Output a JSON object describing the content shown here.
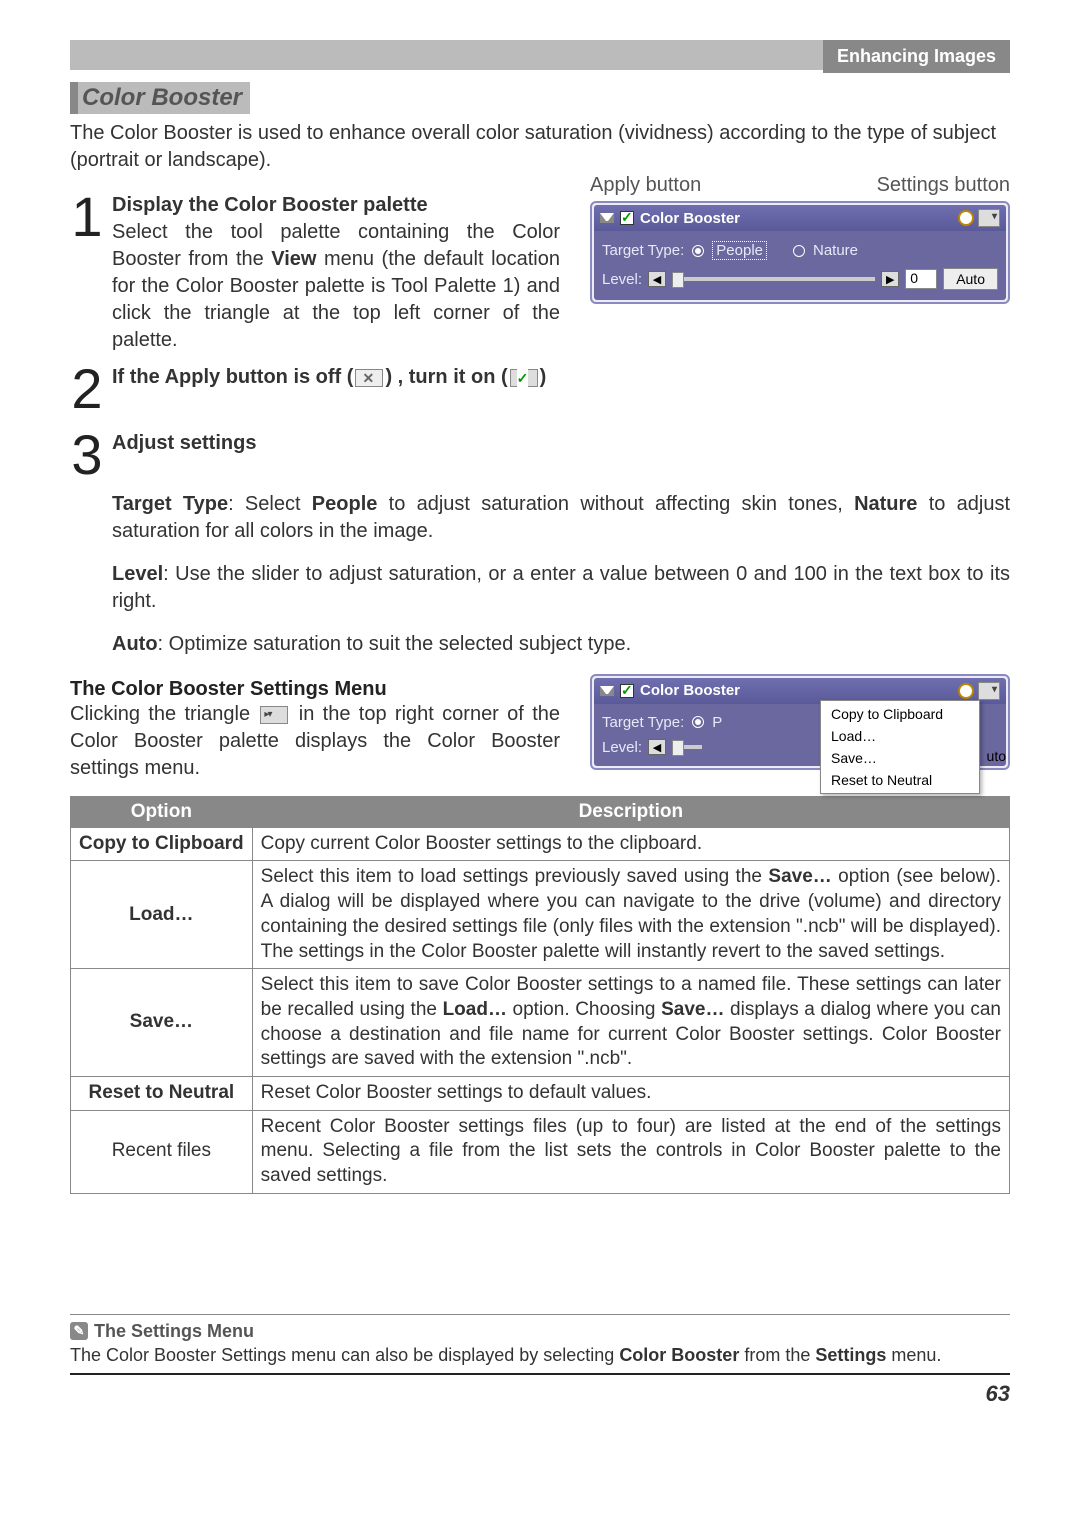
{
  "header": {
    "tab": "Enhancing Images"
  },
  "title": "Color Booster",
  "intro": "The Color Booster is used to enhance overall color saturation (vividness) according to the type of subject (portrait or landscape).",
  "steps": {
    "s1": {
      "num": "1",
      "head": "Display the Color Booster palette",
      "desc_pre": "Select the tool palette containing the Color Booster from the ",
      "desc_bold": "View",
      "desc_post": " menu (the default location for the Color Booster palette is Tool Palette 1) and click the triangle at the top left corner of the palette."
    },
    "s2": {
      "num": "2",
      "head_pre": "If the Apply button is off (",
      "head_mid": ") , turn it on (",
      "head_post": ")"
    },
    "s3": {
      "num": "3",
      "head": "Adjust settings",
      "target_label": "Target Type",
      "target_text_pre": ": Select ",
      "target_b1": "People",
      "target_mid": " to adjust saturation without affecting skin tones, ",
      "target_b2": "Nature",
      "target_post": " to adjust saturation for all colors in the image.",
      "level_label": "Level",
      "level_text": ": Use the slider to adjust saturation, or a enter a value between 0 and 100 in the text box to its right.",
      "auto_label": "Auto",
      "auto_text": ": Optimize saturation to suit the selected subject type."
    }
  },
  "palette_labels": {
    "apply": "Apply button",
    "settings": "Settings button"
  },
  "palette": {
    "title": "Color Booster",
    "target_label": "Target Type:",
    "opt_people": "People",
    "opt_nature": "Nature",
    "level_label": "Level:",
    "level_value": "0",
    "auto": "Auto"
  },
  "settings_menu_section": {
    "head": "The Color Booster Settings Menu",
    "body_pre": "Clicking the triangle ",
    "body_post": " in the top right corner of the Color Booster palette displays the Color Booster settings menu."
  },
  "menu_items": {
    "copy": "Copy to Clipboard",
    "load": "Load…",
    "save": "Save…",
    "reset": "Reset to Neutral"
  },
  "uto": "uto",
  "table": {
    "h1": "Option",
    "h2": "Description",
    "r1n": "Copy to Clipboard",
    "r1d": "Copy current Color Booster settings to the clipboard.",
    "r2n": "Load…",
    "r2d_pre": "Select this item to load settings previously saved using the ",
    "r2d_b": "Save…",
    "r2d_post": " option (see below).  A dialog will be displayed where you can navigate to the drive (volume) and directory containing the desired settings file (only files with the extension \".ncb\" will be displayed).  The settings in the Color Booster palette will instantly revert to the saved settings.",
    "r3n": "Save…",
    "r3d_1": "Select this item to save Color Booster settings to a named file.  These settings can later be recalled using the ",
    "r3d_b1": "Load…",
    "r3d_2": " option.  Choosing ",
    "r3d_b2": "Save…",
    "r3d_3": " displays a dialog where you can choose a destination and file name for current Color Booster settings.  Color Booster settings are saved with the extension \".ncb\".",
    "r4n": "Reset to Neutral",
    "r4d": "Reset Color Booster settings to default values.",
    "r5n": "Recent files",
    "r5d": "Recent Color Booster settings files (up to four) are listed at the end of the settings menu.  Selecting a file from the list sets the controls in Color Booster palette to the saved settings."
  },
  "footnote": {
    "head": "The Settings Menu",
    "body_1": "The Color Booster Settings menu can also be displayed by selecting ",
    "body_b1": "Color Booster",
    "body_2": " from the ",
    "body_b2": "Settings",
    "body_3": " menu."
  },
  "pagenum": "63"
}
